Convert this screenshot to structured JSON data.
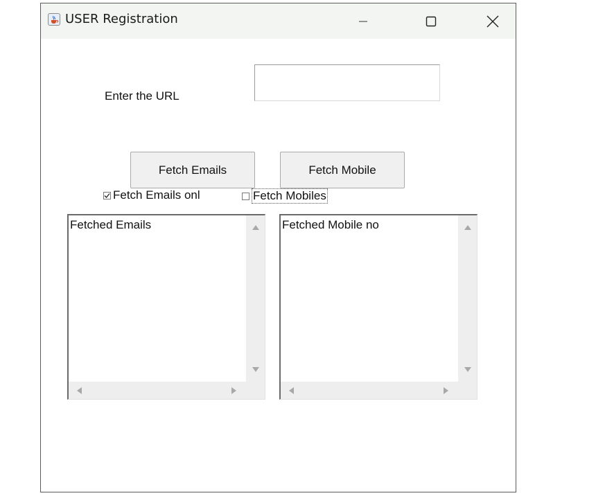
{
  "window": {
    "title": "USER Registration",
    "app_icon": "java-cup-icon",
    "controls": {
      "minimize_icon": "minimize-icon",
      "maximize_icon": "maximize-icon",
      "close_icon": "close-icon"
    }
  },
  "form": {
    "url_label": "Enter the URL",
    "url_value": "",
    "url_placeholder": ""
  },
  "buttons": {
    "fetch_emails": "Fetch Emails",
    "fetch_mobile": "Fetch Mobile"
  },
  "checkboxes": {
    "emails_only": {
      "label": "Fetch Emails onl",
      "checked": true
    },
    "mobiles": {
      "label": "Fetch Mobiles",
      "checked": false
    }
  },
  "results": {
    "emails_text": "Fetched Emails",
    "mobile_text": "Fetched Mobile no"
  },
  "colors": {
    "titlebar_bg": "#f2f5f2",
    "button_bg": "#f0f0f0",
    "scrollbar_bg": "#eeeeee"
  }
}
